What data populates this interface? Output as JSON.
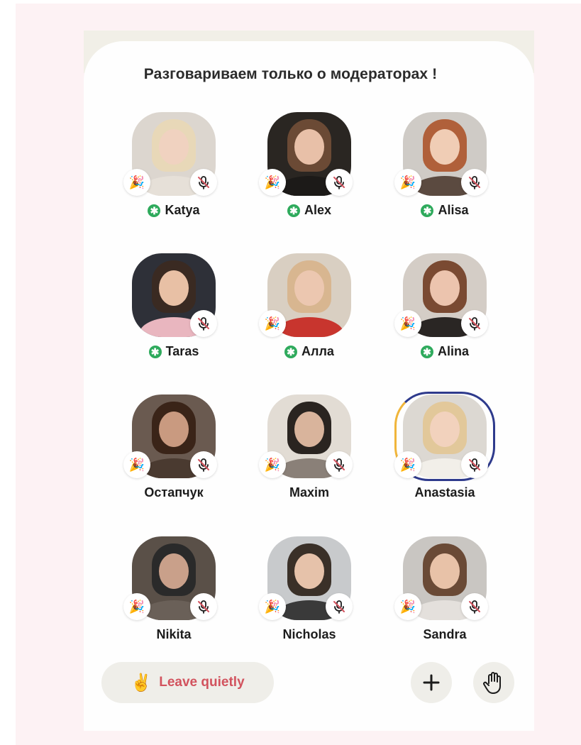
{
  "room": {
    "title": "Разговариваем только о модераторах !"
  },
  "speakers": [
    {
      "name": "Katya",
      "moderator": true,
      "party_icon": "party-popper-icon",
      "mic_icon": "mic-muted-icon"
    },
    {
      "name": "Alex",
      "moderator": true,
      "party_icon": "party-popper-icon",
      "mic_icon": "mic-muted-icon"
    },
    {
      "name": "Alisa",
      "moderator": true,
      "party_icon": "party-popper-icon",
      "mic_icon": "mic-muted-icon"
    },
    {
      "name": "Taras",
      "moderator": true,
      "mic_icon": "mic-muted-icon"
    },
    {
      "name": "Алла",
      "moderator": true,
      "party_icon": "party-popper-icon"
    },
    {
      "name": "Alina",
      "moderator": true,
      "party_icon": "party-popper-icon",
      "mic_icon": "mic-muted-icon"
    },
    {
      "name": "Остапчук",
      "moderator": false,
      "party_icon": "party-popper-icon",
      "mic_icon": "mic-muted-icon"
    },
    {
      "name": "Maxim",
      "moderator": false,
      "party_icon": "party-popper-icon",
      "mic_icon": "mic-muted-icon"
    },
    {
      "name": "Anastasia",
      "moderator": false,
      "party_icon": "party-popper-icon",
      "mic_icon": "mic-muted-icon"
    },
    {
      "name": "Nikita",
      "moderator": false,
      "party_icon": "party-popper-icon",
      "mic_icon": "mic-muted-icon"
    },
    {
      "name": "Nicholas",
      "moderator": false,
      "party_icon": "party-popper-icon",
      "mic_icon": "mic-muted-icon"
    },
    {
      "name": "Sandra",
      "moderator": false,
      "party_icon": "party-popper-icon",
      "mic_icon": "mic-muted-icon"
    }
  ],
  "footer": {
    "leave_label": "Leave quietly",
    "leave_icon": "victory-hand-icon",
    "add_icon": "plus-icon",
    "raise_hand_icon": "raised-hand-icon"
  },
  "colors": {
    "moderator_badge": "#2eaa5c",
    "leave_text": "#d2535e",
    "page_background": "#fdf2f4"
  }
}
